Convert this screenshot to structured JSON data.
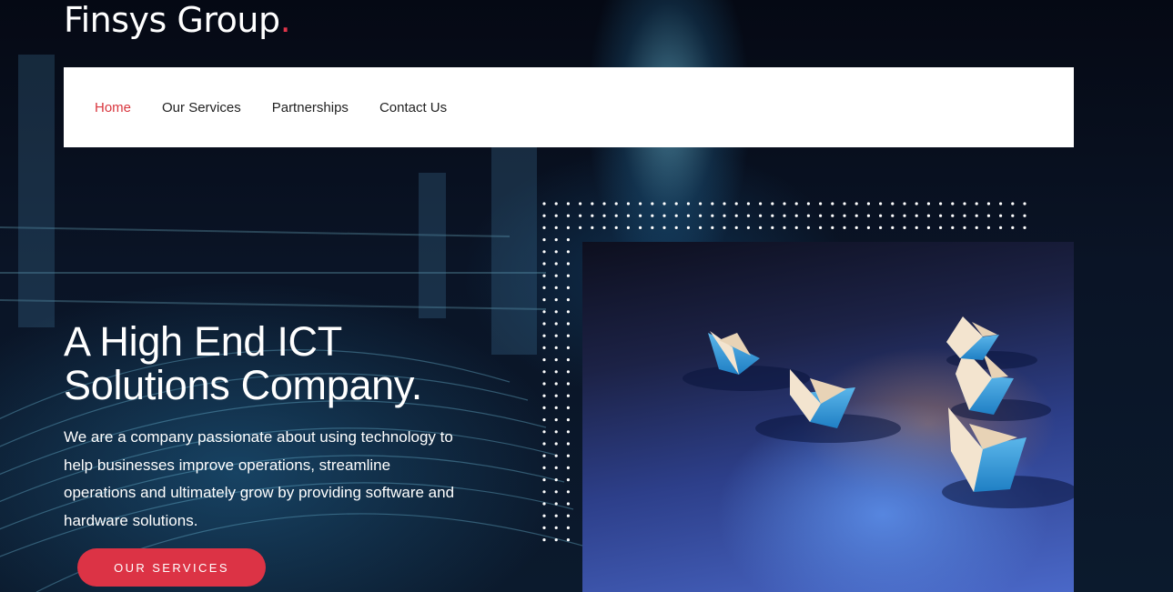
{
  "brand": {
    "name": "Finsys Group",
    "dot": ".",
    "accent_color": "#e0354a"
  },
  "nav": {
    "items": [
      {
        "label": "Home",
        "active": true
      },
      {
        "label": "Our Services",
        "active": false
      },
      {
        "label": "Partnerships",
        "active": false
      },
      {
        "label": "Contact Us",
        "active": false
      }
    ]
  },
  "hero": {
    "title_line1": "A High End ICT",
    "title_line2": "Solutions Company.",
    "description": "We are a company passionate about using technology to help businesses improve operations, streamline operations and ultimately grow by providing software and hardware solutions.",
    "cta_label": "OUR SERVICES",
    "cta_color": "#dc3345"
  },
  "image": {
    "subject": "paper-boats-photo"
  }
}
